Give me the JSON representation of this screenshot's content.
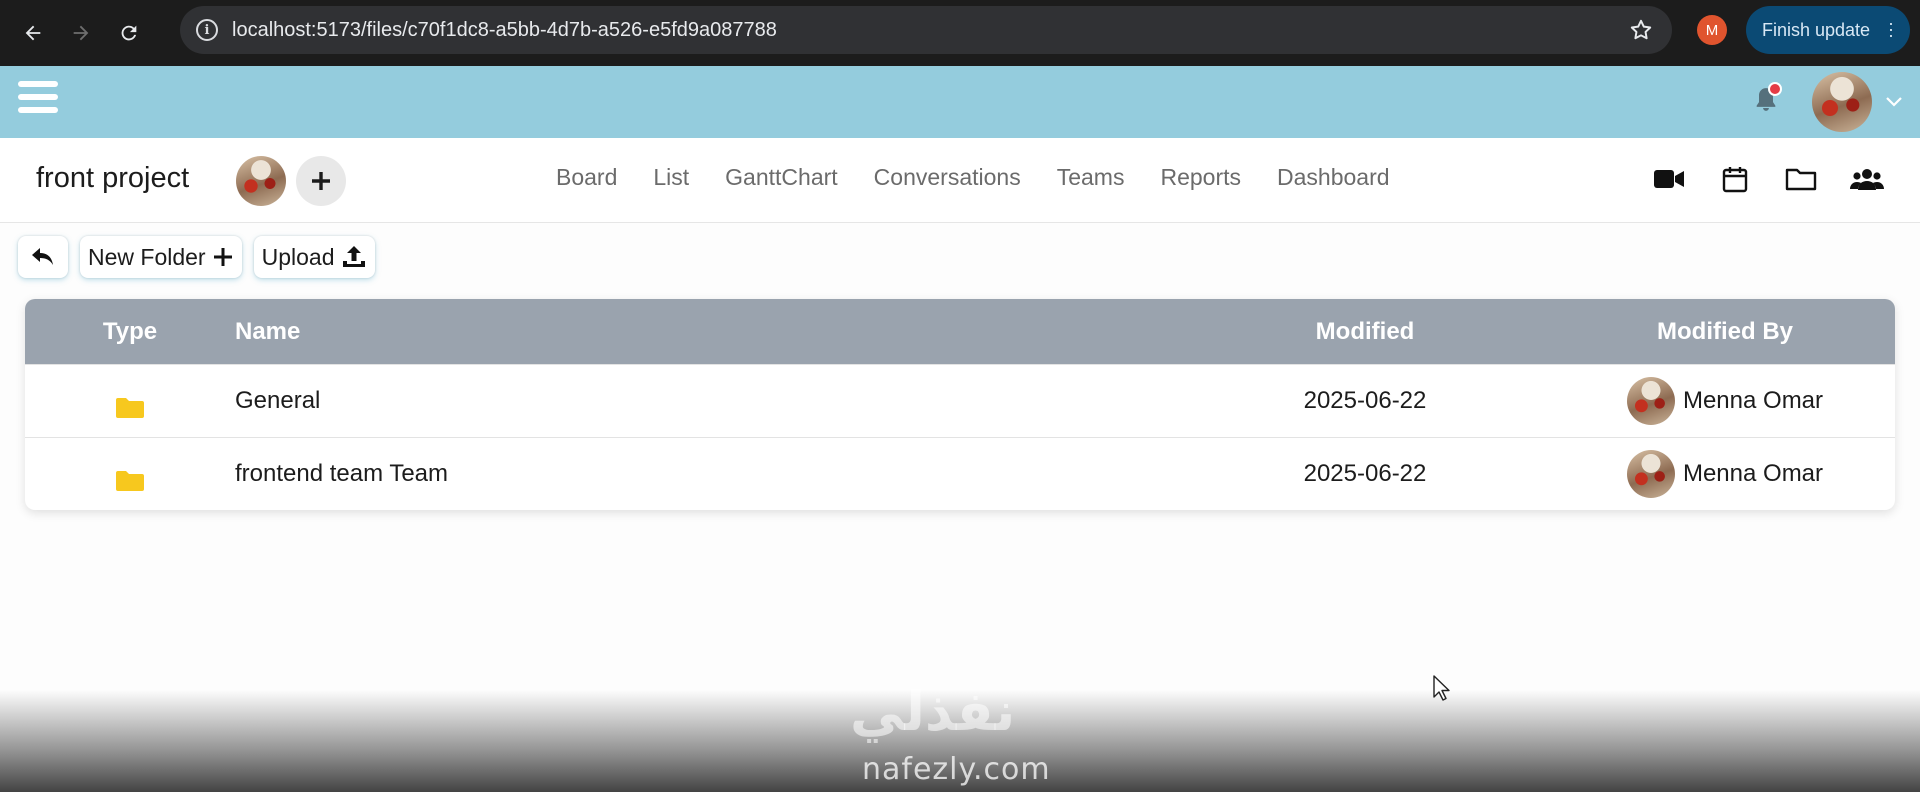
{
  "browser": {
    "url": "localhost:5173/files/c70f1dc8-a5bb-4d7b-a526-e5fd9a087788",
    "profile_initial": "M",
    "finish_update_label": "Finish update",
    "icons": [
      "back-arrow-icon",
      "forward-arrow-icon",
      "reload-icon",
      "info-icon",
      "star-icon",
      "kebab-menu-icon"
    ]
  },
  "appbar": {
    "icons": [
      "hamburger-icon",
      "bell-icon",
      "chevron-down-icon"
    ],
    "bell_dot_color": "#e53c46"
  },
  "project": {
    "title": "front project",
    "nav": [
      "Board",
      "List",
      "GanttChart",
      "Conversations",
      "Teams",
      "Reports",
      "Dashboard"
    ],
    "right_icons": [
      "video-icon",
      "calendar-icon",
      "folder-icon",
      "users-icon"
    ]
  },
  "toolbar": {
    "new_folder_label": "New Folder",
    "upload_label": "Upload"
  },
  "table": {
    "headers": {
      "type": "Type",
      "name": "Name",
      "modified": "Modified",
      "modified_by": "Modified By"
    },
    "rows": [
      {
        "type": "folder-icon",
        "name": "General",
        "modified": "2025-06-22",
        "modified_by": "Menna Omar"
      },
      {
        "type": "folder-icon",
        "name": "frontend team Team",
        "modified": "2025-06-22",
        "modified_by": "Menna Omar"
      }
    ]
  },
  "watermark": {
    "arabic": "نفذلي",
    "url": "nafezly.com"
  },
  "colors": {
    "appbar_bg": "#94ccdd",
    "table_header_bg": "#9aa3ae",
    "folder_yellow": "#f7c81e",
    "finish_update_bg": "#0b4a74"
  }
}
